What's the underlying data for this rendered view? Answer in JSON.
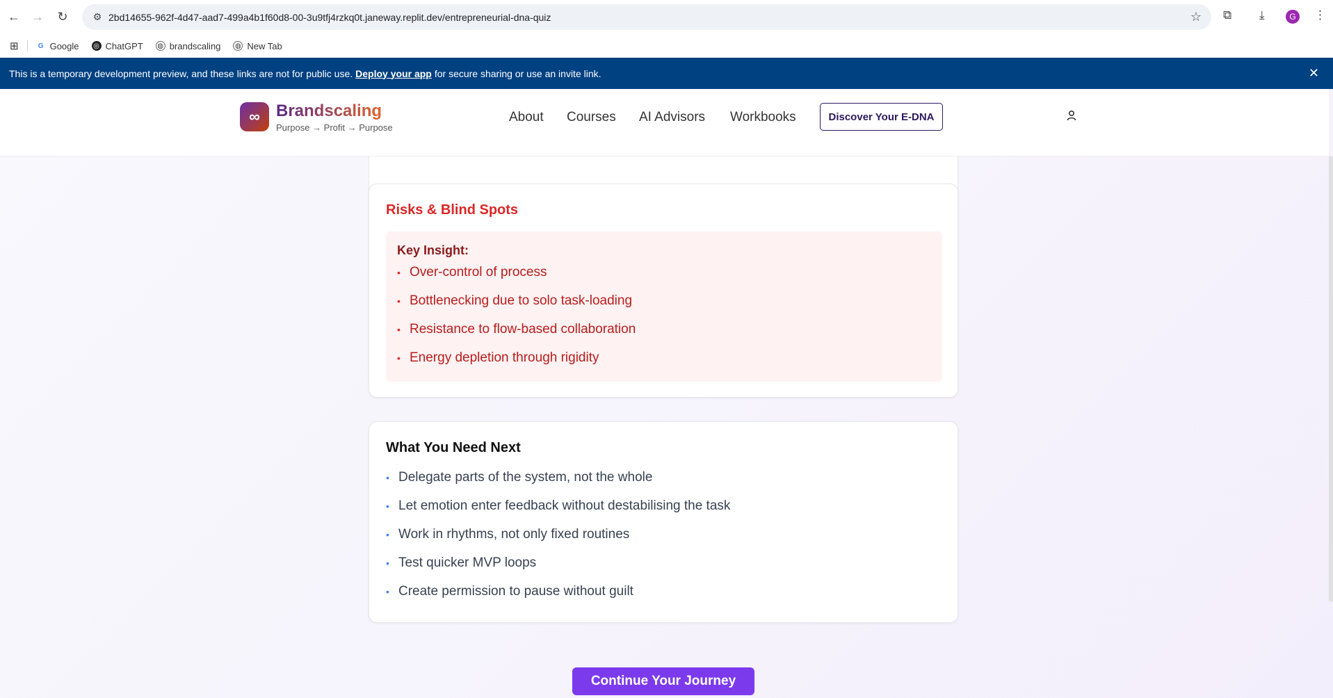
{
  "browser": {
    "url": "2bd14655-962f-4d47-aad7-499a4b1f60d8-00-3u9tfj4rzkq0t.janeway.replit.dev/entrepreneurial-dna-quiz",
    "profile_initial": "G",
    "bookmarks": [
      "Google",
      "ChatGPT",
      "brandscaling",
      "New Tab"
    ]
  },
  "dev_banner": {
    "text_before": "This is a temporary development preview, and these links are not for public use.",
    "link": "Deploy your app",
    "text_after": "for secure sharing or use an invite link."
  },
  "header": {
    "brand": "Brandscaling",
    "tagline": "Purpose → Profit → Purpose",
    "nav": [
      "About",
      "Courses",
      "AI Advisors",
      "Workbooks"
    ],
    "cta": "Discover Your E-DNA"
  },
  "risks": {
    "title": "Risks & Blind Spots",
    "insight_label": "Key Insight:",
    "items": [
      "Over-control of process",
      "Bottlenecking due to solo task-loading",
      "Resistance to flow-based collaboration",
      "Energy depletion through rigidity"
    ]
  },
  "next": {
    "title": "What You Need Next",
    "items": [
      "Delegate parts of the system, not the whole",
      "Let emotion enter feedback without destabilising the task",
      "Work in rhythms, not only fixed routines",
      "Test quicker MVP loops",
      "Create permission to pause without guilt"
    ]
  },
  "continue_button": "Continue Your Journey",
  "colors": {
    "risk_title": "#dc2626",
    "risk_text": "#b91c1c",
    "risk_bg": "#fef2f2",
    "blue_dot": "#3b82f6",
    "cta_purple": "#7c3aed",
    "banner_blue": "#004182"
  }
}
